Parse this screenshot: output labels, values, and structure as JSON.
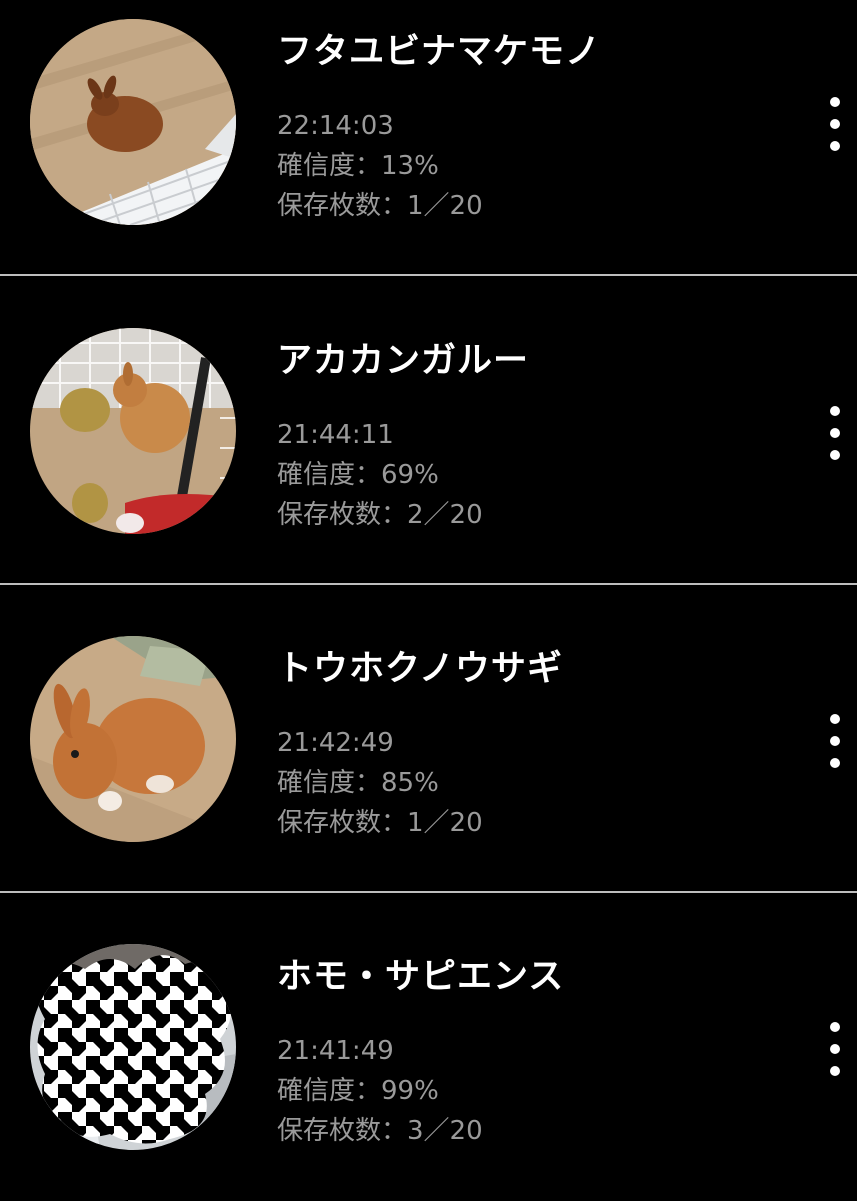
{
  "results": [
    {
      "species": "フタユビナマケモノ",
      "time": "22:14:03",
      "confidence": "確信度：13%",
      "saved": "保存枚数：1／20",
      "thumbnail": "rabbit-on-wood-floor-photo"
    },
    {
      "species": "アカカンガルー",
      "time": "21:44:11",
      "confidence": "確信度：69%",
      "saved": "保存枚数：2／20",
      "thumbnail": "rabbit-in-cage-photo"
    },
    {
      "species": "トウホクノウサギ",
      "time": "21:42:49",
      "confidence": "確信度：85%",
      "saved": "保存枚数：1／20",
      "thumbnail": "rabbit-closeup-photo"
    },
    {
      "species": "ホモ・サピエンス",
      "time": "21:41:49",
      "confidence": "確信度：99%",
      "saved": "保存枚数：3／20",
      "thumbnail": "houndstooth-censored-person-photo"
    }
  ],
  "icons": {
    "menu": "more-vertical-icon"
  },
  "colors": {
    "background": "#000000",
    "title": "#ffffff",
    "meta": "#9a9a9a",
    "divider": "#bdbdbd"
  }
}
